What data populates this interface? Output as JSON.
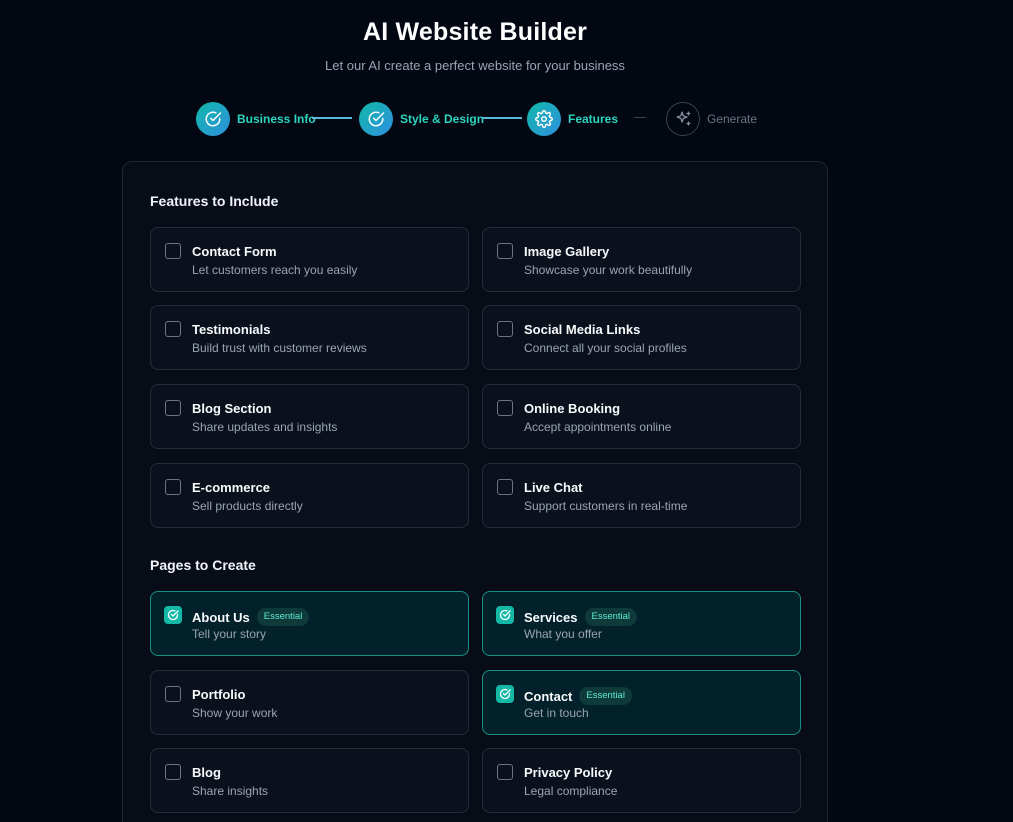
{
  "header": {
    "title": "AI Website Builder",
    "subtitle": "Let our AI create a perfect website for your business"
  },
  "stepper": {
    "steps": [
      {
        "label": "Business Info",
        "status": "completed",
        "icon": "check-circle-icon"
      },
      {
        "label": "Style & Design",
        "status": "completed",
        "icon": "check-circle-icon"
      },
      {
        "label": "Features",
        "status": "current",
        "icon": "gear-icon"
      },
      {
        "label": "Generate",
        "status": "upcoming",
        "icon": "sparkles-icon"
      }
    ]
  },
  "features": {
    "title": "Features to Include",
    "options": [
      {
        "title": "Contact Form",
        "desc": "Let customers reach you easily",
        "checked": false
      },
      {
        "title": "Image Gallery",
        "desc": "Showcase your work beautifully",
        "checked": false
      },
      {
        "title": "Testimonials",
        "desc": "Build trust with customer reviews",
        "checked": false
      },
      {
        "title": "Social Media Links",
        "desc": "Connect all your social profiles",
        "checked": false
      },
      {
        "title": "Blog Section",
        "desc": "Share updates and insights",
        "checked": false
      },
      {
        "title": "Online Booking",
        "desc": "Accept appointments online",
        "checked": false
      },
      {
        "title": "E-commerce",
        "desc": "Sell products directly",
        "checked": false
      },
      {
        "title": "Live Chat",
        "desc": "Support customers in real-time",
        "checked": false
      }
    ]
  },
  "pages": {
    "title": "Pages to Create",
    "options": [
      {
        "title": "About Us",
        "desc": "Tell your story",
        "checked": true,
        "badge": "Essential"
      },
      {
        "title": "Services",
        "desc": "What you offer",
        "checked": true,
        "badge": "Essential"
      },
      {
        "title": "Portfolio",
        "desc": "Show your work",
        "checked": false
      },
      {
        "title": "Contact",
        "desc": "Get in touch",
        "checked": true,
        "badge": "Essential"
      },
      {
        "title": "Blog",
        "desc": "Share insights",
        "checked": false
      },
      {
        "title": "Privacy Policy",
        "desc": "Legal compliance",
        "checked": false
      }
    ]
  },
  "colors": {
    "background": "#020712",
    "accent": "#14b8a6",
    "step_gradient_start": "#10b8a8",
    "step_gradient_end": "#2f8fe0"
  }
}
